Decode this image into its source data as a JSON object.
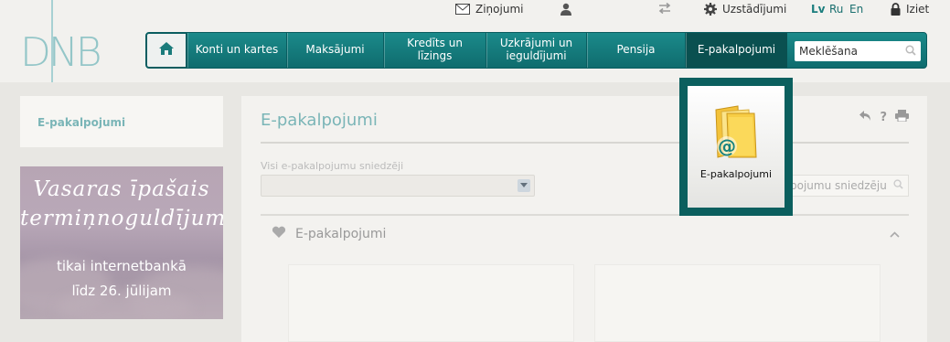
{
  "brand": {
    "logo_text": "DNB",
    "accent": "#0f6c6e",
    "light_accent": "#7ab5b7"
  },
  "topbar": {
    "messages": "Ziņojumi",
    "settings": "Uzstādījumi",
    "langs": [
      "Lv",
      "Ru",
      "En"
    ],
    "active_lang": "Lv",
    "logout": "Iziet"
  },
  "nav": {
    "home_icon": "home-icon",
    "items": [
      {
        "label": "Konti un kartes"
      },
      {
        "label": "Maksājumi"
      },
      {
        "label": "Kredīts un līzings"
      },
      {
        "label": "Uzkrājumi un ieguldījumi"
      },
      {
        "label": "Pensija"
      },
      {
        "label": "E-pakalpojumi"
      }
    ],
    "active": "E-pakalpojumi",
    "search_placeholder": "Meklēšana"
  },
  "sidebar": {
    "item": "E-pakalpojumi",
    "promo": {
      "line1": "Vasaras īpašais",
      "line2": "termiņnoguldījums",
      "line3": "tikai internetbankā",
      "line4": "līdz 26. jūlijam"
    }
  },
  "main": {
    "title": "E-pakalpojumi",
    "filter_label": "Visi e-pakalpojumu sniedzēji",
    "provider_search": "pojumu sniedzēju",
    "section_title": "E-pakalpojumi",
    "toolbar_icons": [
      "back-icon",
      "help-icon",
      "print-icon"
    ]
  },
  "popup": {
    "label": "E-pakalpojumi",
    "icon": "folder-at-icon"
  }
}
